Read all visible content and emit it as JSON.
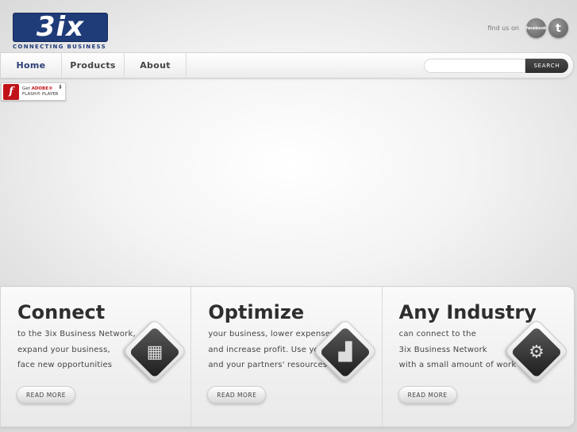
{
  "header": {
    "logo_text": "3ix",
    "logo_tagline": "CONNECTING BUSINESS",
    "find_us": "find us on",
    "facebook_label": "facebook",
    "twitter_label": "t"
  },
  "nav": {
    "items": [
      {
        "label": "Home"
      },
      {
        "label": "Products"
      },
      {
        "label": "About"
      }
    ],
    "search_placeholder": "",
    "search_button": "SEARCH"
  },
  "flash_badge": {
    "get": "Get",
    "adobe": "ADOBE®",
    "player": "FLASH® PLAYER"
  },
  "panels": [
    {
      "title": "Connect",
      "lines": [
        "to the 3ix Business Network,",
        "expand your business,",
        "face new opportunities"
      ],
      "icon": "network-icon",
      "button": "READ MORE"
    },
    {
      "title": "Optimize",
      "lines": [
        "your business, lower expenses",
        "and increase profit. Use your",
        "and your partners' resources"
      ],
      "icon": "chart-growth-icon",
      "button": "READ MORE"
    },
    {
      "title": "Any Industry",
      "lines": [
        "can connect to the",
        "3ix Business Network",
        "with a small amount of work"
      ],
      "icon": "gears-icon",
      "button": "READ MORE"
    }
  ],
  "colors": {
    "brand": "#1f3b78",
    "search_button": "#333333",
    "flash_red": "#c1121a"
  }
}
